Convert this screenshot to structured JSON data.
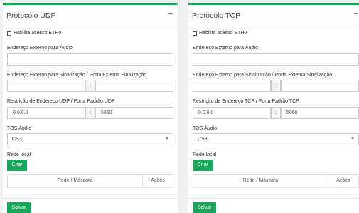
{
  "panels": [
    {
      "title": "Protocolo UDP",
      "collapse": "−",
      "checkbox_label": "Habilita acesso ETH0",
      "external_audio_label": "Endereço Externo para Áudio",
      "external_audio_value": "",
      "signal_label": "Endereço Externo para Sinalização / Porta Externa Sinalização",
      "signal_address": "",
      "signal_sep": ":",
      "signal_port": "",
      "restrict_label": "Restrição de Endereço UDP / Porta Padrão UDP",
      "restrict_address": "0.0.0.0",
      "restrict_sep": ":",
      "restrict_port": "5060",
      "tos_label": "TOS Áudio",
      "tos_value": "CS3",
      "tos_caret": "▼",
      "lan_label": "Rede local",
      "create_button": "Criar",
      "table_headers": [
        "Rede / Máscara",
        "Ações"
      ],
      "save_button": "Salvar"
    },
    {
      "title": "Protocolo TCP",
      "collapse": "−",
      "checkbox_label": "Habilita acesso ETH0",
      "external_audio_label": "Endereço Externo para Áudio",
      "external_audio_value": "",
      "signal_label": "Endereço Externo para Sinalização / Porta Externa Sinalização",
      "signal_address": "",
      "signal_sep": ":",
      "signal_port": "",
      "restrict_label": "Restrição de Endereço TCP / Porta Padrão TCP",
      "restrict_address": "0.0.0.0",
      "restrict_sep": ":",
      "restrict_port": "5060",
      "tos_label": "TOS Áudio",
      "tos_value": "CS3",
      "tos_caret": "▼",
      "lan_label": "Rede local",
      "create_button": "Criar",
      "table_headers": [
        "Rede / Máscara",
        "Ações"
      ],
      "save_button": "Salvar"
    }
  ],
  "colors": {
    "accent": "#19a85b",
    "border": "#cccccc",
    "background": "#f0f0f0"
  }
}
